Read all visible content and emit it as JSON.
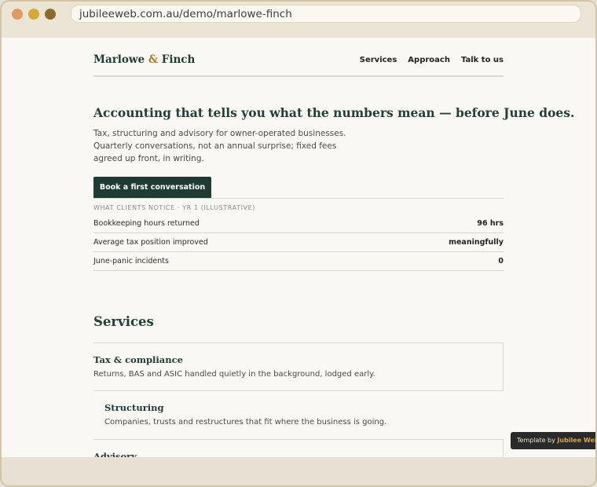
{
  "window": {
    "url": "jubileeweb.com.au/demo/marlowe-finch"
  },
  "nav": {
    "brand_part1": "Marlowe",
    "brand_amp": "&",
    "brand_part2": "Finch",
    "links": [
      "Services",
      "Approach",
      "Talk to us"
    ]
  },
  "hero": {
    "headline": "Accounting that tells you what the numbers mean — before June does.",
    "lede_lines": [
      "Tax, structuring and advisory for owner-operated businesses.",
      "Quarterly conversations, not an annual surprise; fixed fees",
      "agreed up front, in writing."
    ],
    "cta_label": "Book a first conversation"
  },
  "stats": {
    "caption": "WHAT CLIENTS NOTICE · YR 1 (ILLUSTRATIVE)",
    "rows": [
      {
        "label": "Bookkeeping hours returned",
        "value": "96 hrs"
      },
      {
        "label": "Average tax position improved",
        "value": "meaningfully"
      },
      {
        "label": "June-panic incidents",
        "value": "0"
      }
    ]
  },
  "services": {
    "title": "Services",
    "items": [
      {
        "title": "Tax & compliance",
        "desc": "Returns, BAS and ASIC handled quietly in the background, lodged early."
      },
      {
        "title": "Structuring",
        "desc": "Companies, trusts and restructures that fit where the business is going."
      },
      {
        "title": "Advisory",
        "desc": ""
      }
    ]
  },
  "badge": {
    "prefix": "Template by",
    "name": "Jubilee Web"
  },
  "colors": {
    "brand_green": "#1f3b33",
    "accent_gold": "#a8792f",
    "page_bg": "#faf8f4"
  }
}
